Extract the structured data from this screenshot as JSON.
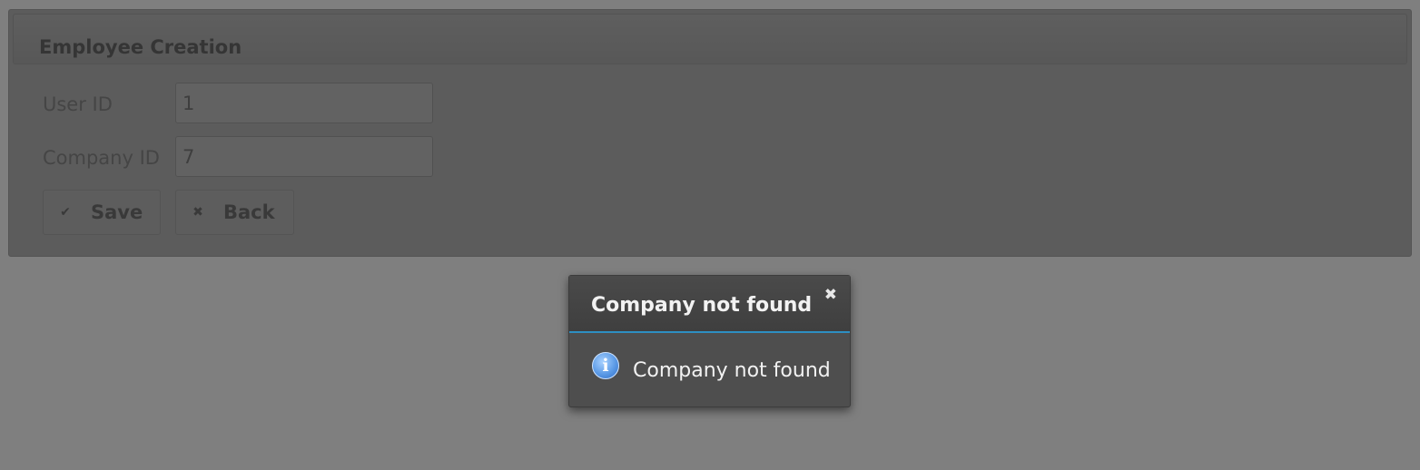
{
  "form": {
    "title": "Employee Creation",
    "fields": [
      {
        "label": "User ID",
        "value": "1"
      },
      {
        "label": "Company ID",
        "value": "7"
      }
    ],
    "buttons": {
      "save_icon": "✔",
      "save_label": "Save",
      "back_icon": "✖",
      "back_label": "Back"
    }
  },
  "dialog": {
    "title": "Company not found",
    "close_icon": "✖",
    "icon": "info-icon",
    "icon_glyph": "i",
    "message": "Company not found",
    "accent_color": "#2e8fc2"
  }
}
